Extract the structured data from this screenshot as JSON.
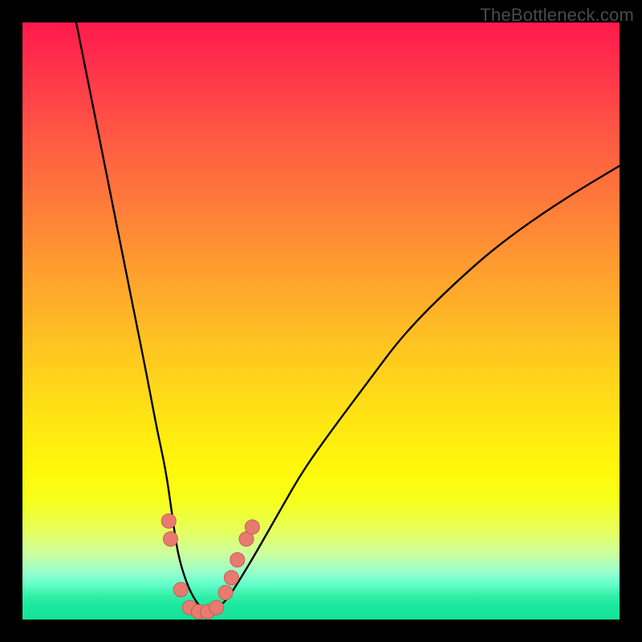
{
  "watermark": "TheBottleneck.com",
  "colors": {
    "page_bg": "#000000",
    "curve": "#000000",
    "dot_fill": "#e77b70",
    "dot_stroke": "#c95c54",
    "gradient_stops": [
      "#ff1a4d",
      "#ff374a",
      "#ff5544",
      "#ff7a3a",
      "#ffa02e",
      "#ffc421",
      "#ffe414",
      "#fff80a",
      "#f7ff1a",
      "#e6ff5a",
      "#ccffa0",
      "#99ffcc",
      "#66ffcc",
      "#33f0a8",
      "#1de9a0",
      "#14e29a"
    ]
  },
  "chart_data": {
    "type": "line",
    "title": "",
    "xlabel": "",
    "ylabel": "",
    "xlim": [
      0,
      100
    ],
    "ylim": [
      0,
      100
    ],
    "grid": false,
    "series": [
      {
        "name": "bottleneck-curve",
        "x": [
          9,
          11,
          13,
          15,
          17,
          19,
          21,
          22.5,
          24,
          25,
          26,
          27.5,
          29,
          30.5,
          32,
          34,
          36,
          39,
          43,
          47,
          52,
          58,
          64,
          72,
          80,
          90,
          100
        ],
        "y": [
          100,
          90,
          80,
          70,
          60,
          50,
          40,
          32,
          25,
          18,
          11,
          6,
          3,
          1.5,
          1.5,
          3,
          6,
          11,
          18,
          25,
          32,
          40,
          48,
          56,
          63,
          70,
          76
        ]
      }
    ],
    "dots": [
      {
        "x": 24.5,
        "y": 16.5
      },
      {
        "x": 24.8,
        "y": 13.5
      },
      {
        "x": 26.5,
        "y": 5.0
      },
      {
        "x": 28.0,
        "y": 2.0
      },
      {
        "x": 29.5,
        "y": 1.3
      },
      {
        "x": 31.0,
        "y": 1.3
      },
      {
        "x": 32.5,
        "y": 2.0
      },
      {
        "x": 34.0,
        "y": 4.5
      },
      {
        "x": 35.0,
        "y": 7.0
      },
      {
        "x": 36.0,
        "y": 10.0
      },
      {
        "x": 37.5,
        "y": 13.5
      },
      {
        "x": 38.5,
        "y": 15.5
      }
    ],
    "dot_radius_px": 9
  }
}
